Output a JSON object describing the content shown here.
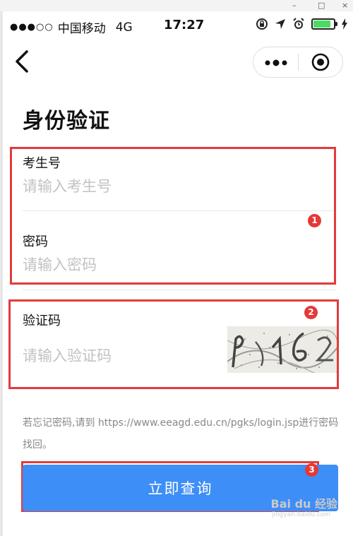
{
  "window": {
    "minimize": "–",
    "maximize": "□",
    "close": "×"
  },
  "status_bar": {
    "signal": "●●●○○",
    "carrier": "中国移动",
    "network": "4G",
    "time": "17:27"
  },
  "page": {
    "title": "身份验证"
  },
  "form": {
    "exam_number": {
      "label": "考生号",
      "placeholder": "请输入考生号"
    },
    "password": {
      "label": "密码",
      "placeholder": "请输入密码"
    },
    "captcha": {
      "label": "验证码",
      "placeholder": "请输入验证码"
    }
  },
  "badges": [
    "1",
    "2",
    "3"
  ],
  "hint_text": "若忘记密码,请到 https://www.eeagd.edu.cn/pgks/login.jsp进行密码找回。",
  "submit_label": "立即查询",
  "watermark": {
    "brand": "Bai du 经验",
    "url": "jingyan.baidu.com"
  },
  "colors": {
    "accent": "#3d8ef6",
    "annotation": "#e33b3b",
    "battery": "#4cd964"
  },
  "icons": {
    "back": "chevron-left-icon",
    "more": "more-dots-icon",
    "close_mini": "target-icon"
  }
}
